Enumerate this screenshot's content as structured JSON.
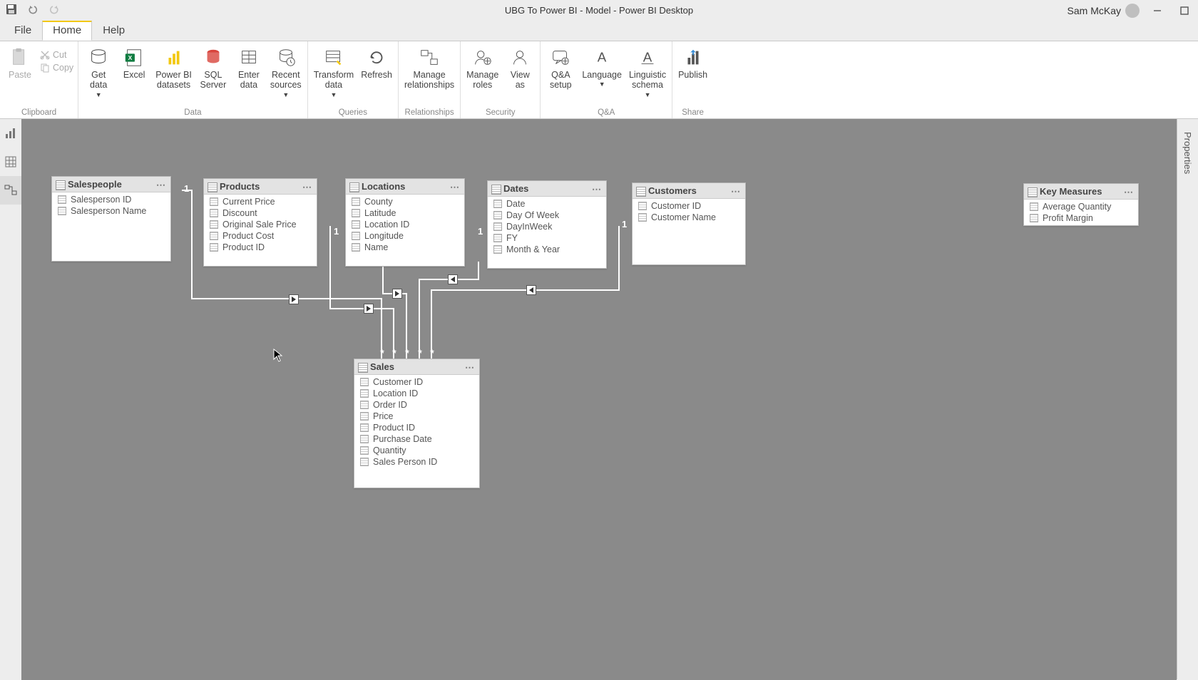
{
  "app": {
    "title": "UBG To Power BI - Model - Power BI Desktop",
    "user": "Sam McKay"
  },
  "menubar": {
    "file": "File",
    "home": "Home",
    "help": "Help"
  },
  "qat": {
    "undo_tip": "Undo",
    "redo_tip": "Redo"
  },
  "ribbon": {
    "clipboard": {
      "paste": "Paste",
      "cut": "Cut",
      "copy": "Copy",
      "group": "Clipboard"
    },
    "data": {
      "getdata": "Get\ndata",
      "excel": "Excel",
      "pbids": "Power BI\ndatasets",
      "sql": "SQL\nServer",
      "enter": "Enter\ndata",
      "recent": "Recent\nsources",
      "group": "Data"
    },
    "queries": {
      "transform": "Transform\ndata",
      "refresh": "Refresh",
      "group": "Queries"
    },
    "relationships": {
      "manage": "Manage\nrelationships",
      "group": "Relationships"
    },
    "security": {
      "manageroles": "Manage\nroles",
      "viewas": "View\nas",
      "group": "Security"
    },
    "qa": {
      "setup": "Q&A\nsetup",
      "language": "Language",
      "schema": "Linguistic\nschema",
      "group": "Q&A"
    },
    "share": {
      "publish": "Publish",
      "group": "Share"
    }
  },
  "sidepanel": {
    "properties": "Properties"
  },
  "tables": {
    "salespeople": {
      "title": "Salespeople",
      "fields": [
        "Salesperson ID",
        "Salesperson Name"
      ]
    },
    "products": {
      "title": "Products",
      "fields": [
        "Current Price",
        "Discount",
        "Original Sale Price",
        "Product Cost",
        "Product ID"
      ]
    },
    "locations": {
      "title": "Locations",
      "fields": [
        "County",
        "Latitude",
        "Location ID",
        "Longitude",
        "Name"
      ]
    },
    "dates": {
      "title": "Dates",
      "fields": [
        "Date",
        "Day Of Week",
        "DayInWeek",
        "FY",
        "Month & Year"
      ]
    },
    "customers": {
      "title": "Customers",
      "fields": [
        "Customer ID",
        "Customer Name"
      ]
    },
    "keymeasures": {
      "title": "Key Measures",
      "fields": [
        "Average Quantity",
        "Profit Margin"
      ]
    },
    "sales": {
      "title": "Sales",
      "fields": [
        "Customer ID",
        "Location ID",
        "Order ID",
        "Price",
        "Product ID",
        "Purchase Date",
        "Quantity",
        "Sales Person ID"
      ]
    }
  },
  "relationship_labels": {
    "one": "1"
  }
}
